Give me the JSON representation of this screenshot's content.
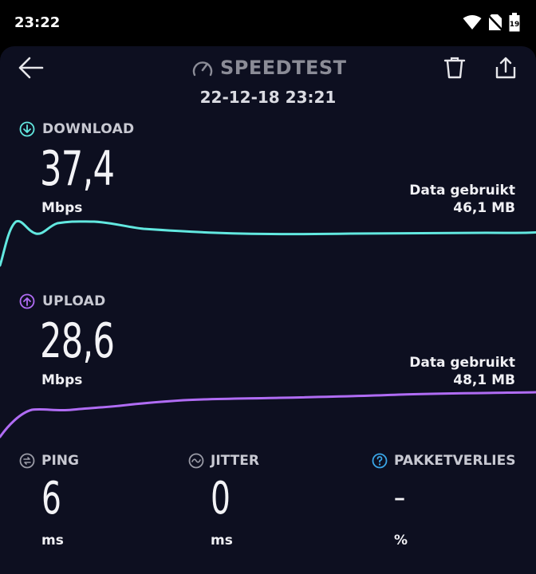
{
  "status_bar": {
    "time": "23:22",
    "battery": "19"
  },
  "header": {
    "title": "SPEEDTEST",
    "datetime": "22-12-18 23:21"
  },
  "download": {
    "label": "DOWNLOAD",
    "value": "37,4",
    "unit": "Mbps",
    "data_used_label": "Data gebruikt",
    "data_used_value": "46,1 MB",
    "color": "#62e8e0"
  },
  "upload": {
    "label": "UPLOAD",
    "value": "28,6",
    "unit": "Mbps",
    "data_used_label": "Data gebruikt",
    "data_used_value": "48,1 MB",
    "color": "#b06cf4"
  },
  "ping": {
    "label": "PING",
    "value": "6",
    "unit": "ms"
  },
  "jitter": {
    "label": "JITTER",
    "value": "0",
    "unit": "ms"
  },
  "packet_loss": {
    "label": "PAKKETVERLIES",
    "value": "–",
    "unit": "%",
    "icon_color": "#3aa6e8"
  }
}
